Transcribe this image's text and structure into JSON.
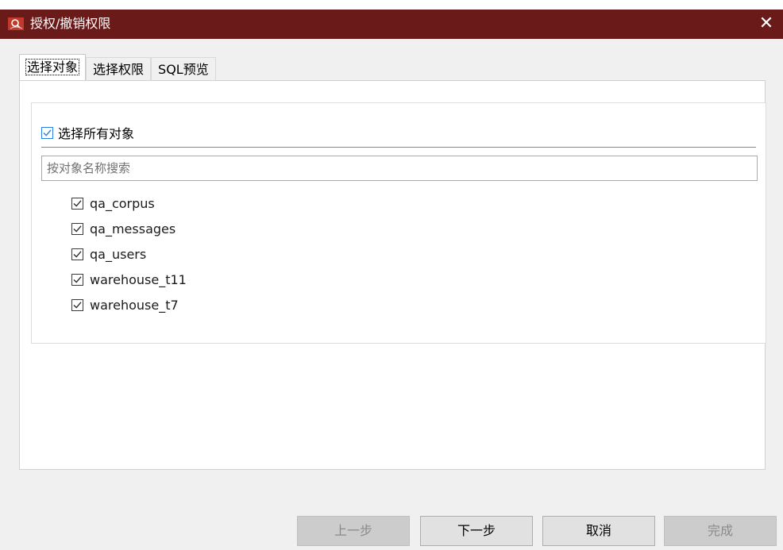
{
  "window": {
    "title": "授权/撤销权限",
    "close_glyph": "✕",
    "titlebar_color": "#6b1a1a"
  },
  "tabs": [
    {
      "label": "选择对象",
      "active": true
    },
    {
      "label": "选择权限",
      "active": false
    },
    {
      "label": "SQL预览",
      "active": false
    }
  ],
  "objects_panel": {
    "select_all_label": "选择所有对象",
    "select_all_checked": true,
    "search_placeholder": "按对象名称搜索",
    "search_value": "",
    "items": [
      {
        "name": "qa_corpus",
        "checked": true
      },
      {
        "name": "qa_messages",
        "checked": true
      },
      {
        "name": "qa_users",
        "checked": true
      },
      {
        "name": "warehouse_t11",
        "checked": true
      },
      {
        "name": "warehouse_t7",
        "checked": true
      }
    ]
  },
  "footer": {
    "prev_label": "上一步",
    "next_label": "下一步",
    "cancel_label": "取消",
    "finish_label": "完成"
  },
  "icons": {
    "app": "app-logo-icon",
    "close": "close-icon",
    "check": "checkmark-icon"
  }
}
